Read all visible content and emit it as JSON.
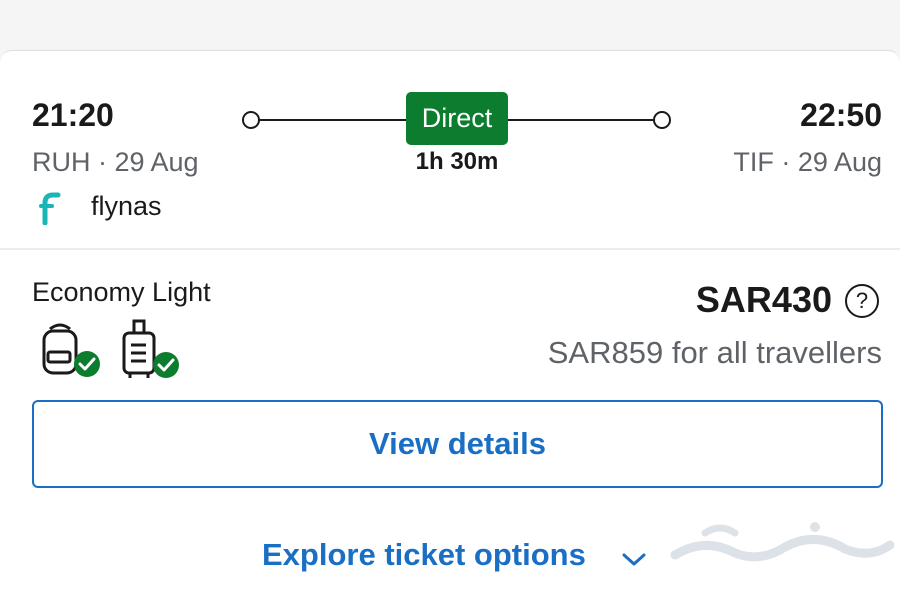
{
  "flight": {
    "departure_time": "21:20",
    "departure_info": "RUH · 29 Aug",
    "arrival_time": "22:50",
    "arrival_info": "TIF · 29 Aug",
    "stops_label": "Direct",
    "duration": "1h 30m",
    "airline": "flynas",
    "airline_logo_icon": "flynas-logo-icon"
  },
  "fare": {
    "name": "Economy Light",
    "price": "SAR430",
    "total_label": "SAR859 for all travellers",
    "help_icon": "help-circle-icon",
    "baggage_icons": [
      "backpack-included-icon",
      "cabin-bag-included-icon"
    ]
  },
  "actions": {
    "view_details": "View details",
    "explore_options": "Explore ticket options"
  },
  "colors": {
    "direct_badge": "#0c7c2e",
    "link_blue": "#1a6fc4",
    "check_green": "#0c7c2e",
    "airline_teal": "#1ab5b5"
  }
}
